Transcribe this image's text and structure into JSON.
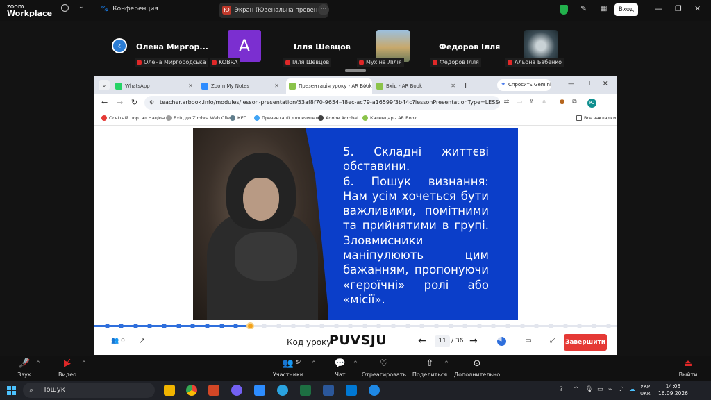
{
  "zoom": {
    "logo_line1": "zoom",
    "logo_line2": "Workplace",
    "info_icon": "info-icon",
    "conference_label": "Конференция",
    "share_badge": "Ю",
    "share_title": "Экран (Ювенальна превенція Л",
    "login_button": "Вход"
  },
  "participants": [
    {
      "name": "Олена  Миргор...",
      "tag": "Олена Миргородська"
    },
    {
      "name": "",
      "tag": "KOBRA",
      "avatar_letter": "A"
    },
    {
      "name": "Ілля Шевцов",
      "tag": "Ілля Шевцов"
    },
    {
      "name": "",
      "tag": "Мухіна Лілія"
    },
    {
      "name": "Федоров Ілля",
      "tag": "Федоров Ілля"
    },
    {
      "name": "",
      "tag": "Альона Бабенко"
    }
  ],
  "browser": {
    "tabs": [
      {
        "label": "WhatsApp",
        "color": "#25d366"
      },
      {
        "label": "Zoom My Notes",
        "color": "#2d8cff"
      },
      {
        "label": "Презентація уроку - AR Book",
        "color": "#8bc34a"
      },
      {
        "label": "Вхід - AR Book",
        "color": "#8bc34a"
      }
    ],
    "gemini_label": "Спросить Gemini",
    "url": "teacher.arbook.info/modules/lesson-presentation/53af8f70-9654-48ec-ac79-a16599f3b44c?lessonPresentationType=LESSON&...",
    "profile_letter": "Ю",
    "bookmarks": [
      {
        "label": "Освітній портал Націон...",
        "color": "#e53935"
      },
      {
        "label": "Вхід до Zimbra Web Clie...",
        "color": "#9e9e9e"
      },
      {
        "label": "КЕП",
        "color": "#607d8b"
      },
      {
        "label": "Презентації для вчител...",
        "color": "#42a5f5"
      },
      {
        "label": "Adobe Acrobat",
        "color": "#424242"
      },
      {
        "label": "Календар - AR Book",
        "color": "#8bc34a"
      }
    ],
    "all_bookmarks": "Все закладки"
  },
  "slide": {
    "lines": [
      "5.  Складні  життєві обставини.",
      "6. Пошук визнання: Нам усім хочеться бути важливими, помітними та прийнятими в групі. Зловмисники маніпулюють цим бажанням, пропонуючи «героїчні» ролі або «місії»."
    ]
  },
  "progress": {
    "current": 11,
    "total": 36,
    "dots": 36
  },
  "controls": {
    "users_count": "0",
    "lesson_code_label": "Код уроку",
    "lesson_code": "PUVSJU",
    "page_current": "11",
    "page_total": "/ 36",
    "end_button": "Завершити"
  },
  "toolbar": {
    "audio": "Звук",
    "video": "Видео",
    "participants": "Участники",
    "participants_count": "54",
    "chat": "Чат",
    "react": "Отреагировать",
    "share": "Поделиться",
    "more": "Дополнительно",
    "leave": "Выйти"
  },
  "taskbar": {
    "search_placeholder": "Пошук",
    "lang_line1": "УКР",
    "lang_line2": "UKR",
    "time": "14:05",
    "date": "16.09.2026"
  }
}
